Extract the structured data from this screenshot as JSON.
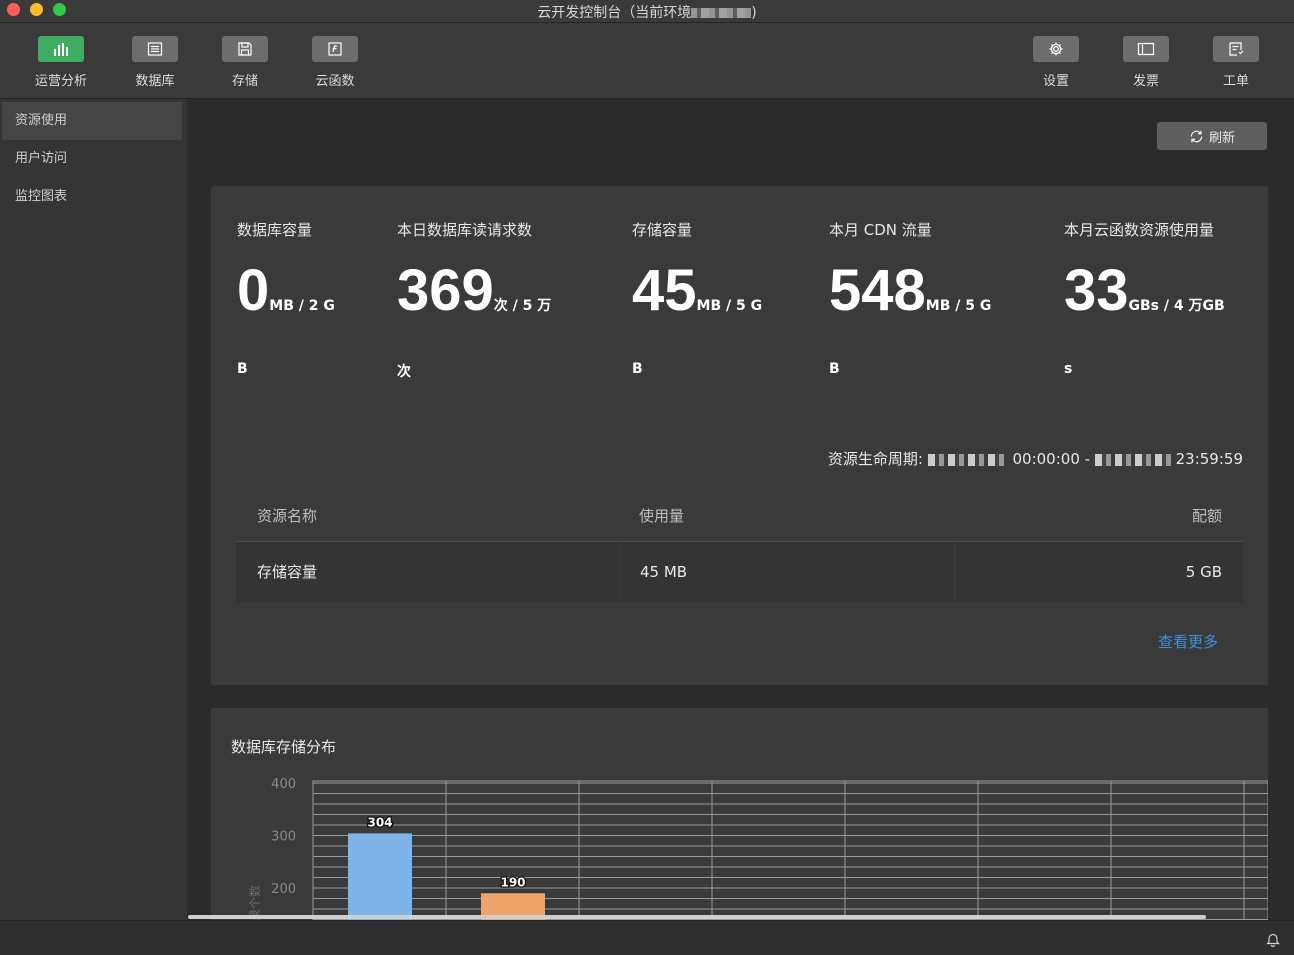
{
  "window": {
    "title": "云开发控制台（当前环境",
    "title_suffix": ")"
  },
  "toolbar": {
    "left": [
      {
        "label": "运营分析",
        "icon": "bar-chart-icon",
        "active": true
      },
      {
        "label": "数据库",
        "icon": "database-icon"
      },
      {
        "label": "存储",
        "icon": "storage-icon"
      },
      {
        "label": "云函数",
        "icon": "cloud-function-icon"
      }
    ],
    "right": [
      {
        "label": "设置",
        "icon": "gear-icon"
      },
      {
        "label": "发票",
        "icon": "invoice-icon"
      },
      {
        "label": "工单",
        "icon": "ticket-icon"
      }
    ]
  },
  "sidebar": {
    "items": [
      {
        "label": "资源使用",
        "active": true
      },
      {
        "label": "用户访问"
      },
      {
        "label": "监控图表"
      }
    ]
  },
  "main": {
    "refresh_label": "刷新",
    "metrics": [
      {
        "title": "数据库容量",
        "value": "0",
        "unit": "MB / 2 G",
        "extra": "B"
      },
      {
        "title": "本日数据库读请求数",
        "value": "369",
        "unit": "次 / 5 万",
        "extra": "次"
      },
      {
        "title": "存储容量",
        "value": "45",
        "unit": "MB / 5 G",
        "extra": "B"
      },
      {
        "title": "本月 CDN 流量",
        "value": "548",
        "unit": "MB / 5 G",
        "extra": "B"
      },
      {
        "title": "本月云函数资源使用量",
        "value": "33",
        "unit": "GBs / 4 万GB",
        "extra": "s"
      }
    ],
    "cycle": {
      "label": "资源生命周期:",
      "start_time": "00:00:00 -",
      "end_time": "23:59:59"
    },
    "table": {
      "headers": [
        "资源名称",
        "使用量",
        "配额"
      ],
      "rows": [
        [
          "存储容量",
          "45 MB",
          "5 GB"
        ]
      ]
    },
    "more_link": "查看更多",
    "chart_card_title": "数据库存储分布"
  },
  "chart_data": {
    "type": "bar",
    "ylabel": "记录个数",
    "yticks": [
      400,
      300,
      200
    ],
    "ylim": [
      0,
      400
    ],
    "values": [
      304,
      190
    ],
    "colors": [
      "#7eb4ea",
      "#eda46a"
    ],
    "grid": true
  }
}
